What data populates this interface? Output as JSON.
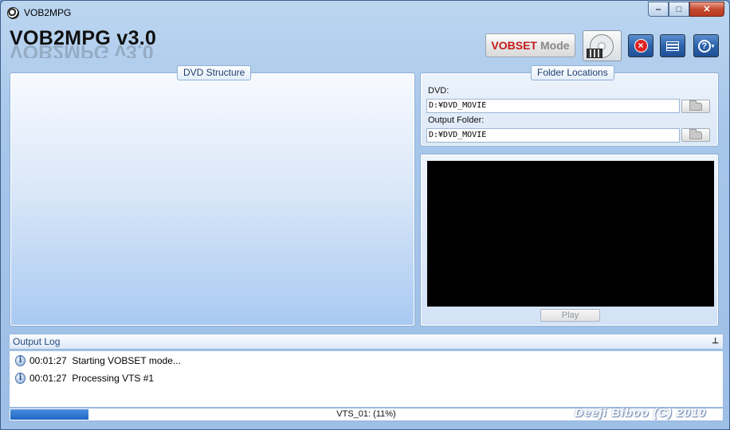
{
  "window": {
    "title": "VOB2MPG"
  },
  "header": {
    "app_title": "VOB2MPG v3.0",
    "vobset_mode": {
      "part1": "VOBSET",
      "part2": "Mode"
    },
    "tools": {
      "close_symbol": "×",
      "help_symbol": "?",
      "help_caret": "▾"
    }
  },
  "dvd_structure": {
    "legend": "DVD Structure"
  },
  "folder_locations": {
    "legend": "Folder Locations",
    "dvd_label": "DVD:",
    "dvd_value": "D:¥DVD_MOVIE",
    "output_label": "Output Folder:",
    "output_value": "D:¥DVD_MOVIE"
  },
  "preview": {
    "play_label": "Play"
  },
  "output_log": {
    "title": "Output Log",
    "pin_symbol": "⊥",
    "entries": [
      {
        "time": "00:01:27",
        "message": "Starting VOBSET mode..."
      },
      {
        "time": "00:01:27",
        "message": "Processing VTS #1"
      }
    ]
  },
  "status": {
    "progress_text": "VTS_01: (11%)",
    "progress_value": 0.11,
    "watermark": "Deeji Biboo (C) 2010"
  },
  "colors": {
    "accent": "#2d63ad",
    "vobset_red": "#c51a1a",
    "progress": "#1f65c4"
  }
}
